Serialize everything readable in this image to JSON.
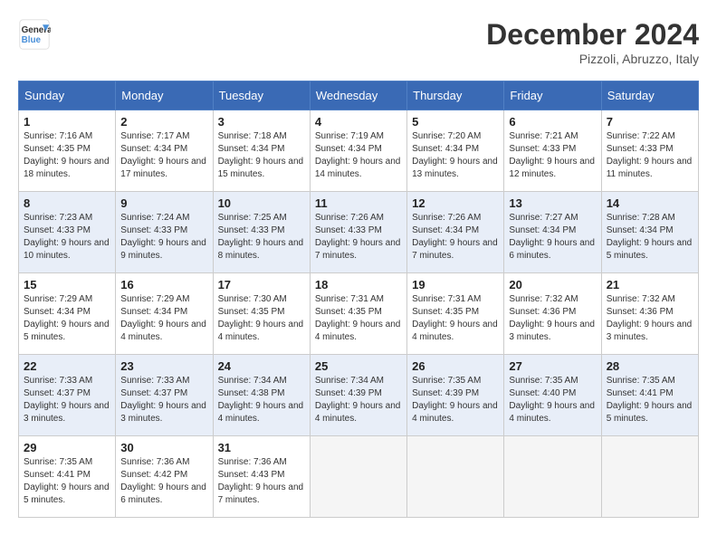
{
  "header": {
    "logo_line1": "General",
    "logo_line2": "Blue",
    "month": "December 2024",
    "location": "Pizzoli, Abruzzo, Italy"
  },
  "weekdays": [
    "Sunday",
    "Monday",
    "Tuesday",
    "Wednesday",
    "Thursday",
    "Friday",
    "Saturday"
  ],
  "rows": [
    [
      {
        "day": "1",
        "sunrise": "7:16 AM",
        "sunset": "4:35 PM",
        "daylight": "9 hours and 18 minutes."
      },
      {
        "day": "2",
        "sunrise": "7:17 AM",
        "sunset": "4:34 PM",
        "daylight": "9 hours and 17 minutes."
      },
      {
        "day": "3",
        "sunrise": "7:18 AM",
        "sunset": "4:34 PM",
        "daylight": "9 hours and 15 minutes."
      },
      {
        "day": "4",
        "sunrise": "7:19 AM",
        "sunset": "4:34 PM",
        "daylight": "9 hours and 14 minutes."
      },
      {
        "day": "5",
        "sunrise": "7:20 AM",
        "sunset": "4:34 PM",
        "daylight": "9 hours and 13 minutes."
      },
      {
        "day": "6",
        "sunrise": "7:21 AM",
        "sunset": "4:33 PM",
        "daylight": "9 hours and 12 minutes."
      },
      {
        "day": "7",
        "sunrise": "7:22 AM",
        "sunset": "4:33 PM",
        "daylight": "9 hours and 11 minutes."
      }
    ],
    [
      {
        "day": "8",
        "sunrise": "7:23 AM",
        "sunset": "4:33 PM",
        "daylight": "9 hours and 10 minutes."
      },
      {
        "day": "9",
        "sunrise": "7:24 AM",
        "sunset": "4:33 PM",
        "daylight": "9 hours and 9 minutes."
      },
      {
        "day": "10",
        "sunrise": "7:25 AM",
        "sunset": "4:33 PM",
        "daylight": "9 hours and 8 minutes."
      },
      {
        "day": "11",
        "sunrise": "7:26 AM",
        "sunset": "4:33 PM",
        "daylight": "9 hours and 7 minutes."
      },
      {
        "day": "12",
        "sunrise": "7:26 AM",
        "sunset": "4:34 PM",
        "daylight": "9 hours and 7 minutes."
      },
      {
        "day": "13",
        "sunrise": "7:27 AM",
        "sunset": "4:34 PM",
        "daylight": "9 hours and 6 minutes."
      },
      {
        "day": "14",
        "sunrise": "7:28 AM",
        "sunset": "4:34 PM",
        "daylight": "9 hours and 5 minutes."
      }
    ],
    [
      {
        "day": "15",
        "sunrise": "7:29 AM",
        "sunset": "4:34 PM",
        "daylight": "9 hours and 5 minutes."
      },
      {
        "day": "16",
        "sunrise": "7:29 AM",
        "sunset": "4:34 PM",
        "daylight": "9 hours and 4 minutes."
      },
      {
        "day": "17",
        "sunrise": "7:30 AM",
        "sunset": "4:35 PM",
        "daylight": "9 hours and 4 minutes."
      },
      {
        "day": "18",
        "sunrise": "7:31 AM",
        "sunset": "4:35 PM",
        "daylight": "9 hours and 4 minutes."
      },
      {
        "day": "19",
        "sunrise": "7:31 AM",
        "sunset": "4:35 PM",
        "daylight": "9 hours and 4 minutes."
      },
      {
        "day": "20",
        "sunrise": "7:32 AM",
        "sunset": "4:36 PM",
        "daylight": "9 hours and 3 minutes."
      },
      {
        "day": "21",
        "sunrise": "7:32 AM",
        "sunset": "4:36 PM",
        "daylight": "9 hours and 3 minutes."
      }
    ],
    [
      {
        "day": "22",
        "sunrise": "7:33 AM",
        "sunset": "4:37 PM",
        "daylight": "9 hours and 3 minutes."
      },
      {
        "day": "23",
        "sunrise": "7:33 AM",
        "sunset": "4:37 PM",
        "daylight": "9 hours and 3 minutes."
      },
      {
        "day": "24",
        "sunrise": "7:34 AM",
        "sunset": "4:38 PM",
        "daylight": "9 hours and 4 minutes."
      },
      {
        "day": "25",
        "sunrise": "7:34 AM",
        "sunset": "4:39 PM",
        "daylight": "9 hours and 4 minutes."
      },
      {
        "day": "26",
        "sunrise": "7:35 AM",
        "sunset": "4:39 PM",
        "daylight": "9 hours and 4 minutes."
      },
      {
        "day": "27",
        "sunrise": "7:35 AM",
        "sunset": "4:40 PM",
        "daylight": "9 hours and 4 minutes."
      },
      {
        "day": "28",
        "sunrise": "7:35 AM",
        "sunset": "4:41 PM",
        "daylight": "9 hours and 5 minutes."
      }
    ],
    [
      {
        "day": "29",
        "sunrise": "7:35 AM",
        "sunset": "4:41 PM",
        "daylight": "9 hours and 5 minutes."
      },
      {
        "day": "30",
        "sunrise": "7:36 AM",
        "sunset": "4:42 PM",
        "daylight": "9 hours and 6 minutes."
      },
      {
        "day": "31",
        "sunrise": "7:36 AM",
        "sunset": "4:43 PM",
        "daylight": "9 hours and 7 minutes."
      },
      null,
      null,
      null,
      null
    ]
  ]
}
